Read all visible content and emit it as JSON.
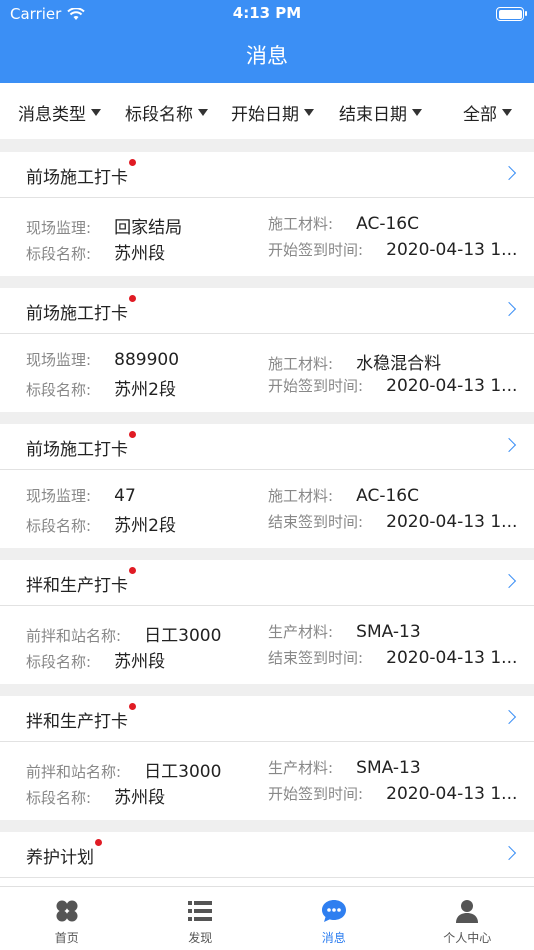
{
  "status": {
    "carrier": "Carrier",
    "time": "4:13 PM"
  },
  "header": {
    "title": "消息"
  },
  "filters": [
    {
      "label": "消息类型"
    },
    {
      "label": "标段名称"
    },
    {
      "label": "开始日期"
    },
    {
      "label": "结束日期"
    },
    {
      "label": "全部"
    }
  ],
  "cards": [
    {
      "title": "前场施工打卡",
      "l1": "现场监理:",
      "v1": "回家结局",
      "l2": "施工材料:",
      "v2": "AC-16C",
      "l3": "标段名称:",
      "v3": "苏州段",
      "l4": "开始签到时间:",
      "v4": "2020-04-13 1..."
    },
    {
      "title": "前场施工打卡",
      "l1": "现场监理:",
      "v1": "889900",
      "l2": "施工材料:",
      "v2": "水稳混合料",
      "l3": "标段名称:",
      "v3": "苏州2段",
      "l4": "开始签到时间:",
      "v4": "2020-04-13 1..."
    },
    {
      "title": "前场施工打卡",
      "l1": "现场监理:",
      "v1": "47",
      "l2": "施工材料:",
      "v2": "AC-16C",
      "l3": "标段名称:",
      "v3": "苏州2段",
      "l4": "结束签到时间:",
      "v4": "2020-04-13 1..."
    },
    {
      "title": "拌和生产打卡",
      "l1": "前拌和站名称:",
      "v1": "日工3000",
      "l2": "生产材料:",
      "v2": "SMA-13",
      "l3": "标段名称:",
      "v3": "苏州段",
      "l4": "结束签到时间:",
      "v4": "2020-04-13 1..."
    },
    {
      "title": "拌和生产打卡",
      "l1": "前拌和站名称:",
      "v1": "日工3000",
      "l2": "生产材料:",
      "v2": "SMA-13",
      "l3": "标段名称:",
      "v3": "苏州段",
      "l4": "开始签到时间:",
      "v4": "2020-04-13 1..."
    },
    {
      "title": "养护计划"
    }
  ],
  "tabs": [
    {
      "label": "首页",
      "icon": "grid-icon"
    },
    {
      "label": "发现",
      "icon": "list-icon"
    },
    {
      "label": "消息",
      "icon": "chat-icon"
    },
    {
      "label": "个人中心",
      "icon": "person-icon"
    }
  ],
  "colors": {
    "primary": "#3b8ff5",
    "unread_dot": "#e01b24"
  }
}
